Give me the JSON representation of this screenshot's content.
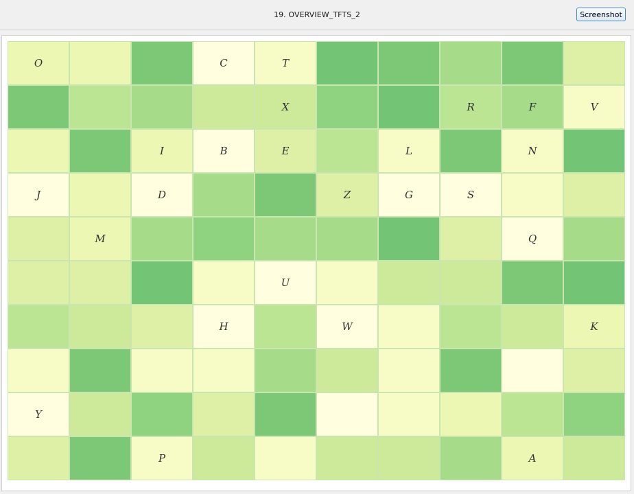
{
  "window": {
    "title": "19. OVERVIEW_TFTS_2",
    "screenshot_button_label": "Screenshot"
  },
  "grid": {
    "palette": [
      "#ffffe0",
      "#f7fbc6",
      "#ecf7b4",
      "#deefa6",
      "#cdea9a",
      "#bce593",
      "#a6dc89",
      "#8fd27f",
      "#7cc876",
      "#74c475"
    ],
    "rows": [
      [
        {
          "label": "O",
          "shade": 2
        },
        {
          "label": "",
          "shade": 2
        },
        {
          "label": "",
          "shade": 8
        },
        {
          "label": "C",
          "shade": 0
        },
        {
          "label": "T",
          "shade": 1
        },
        {
          "label": "",
          "shade": 9
        },
        {
          "label": "",
          "shade": 8
        },
        {
          "label": "",
          "shade": 6
        },
        {
          "label": "",
          "shade": 8
        },
        {
          "label": "",
          "shade": 3
        }
      ],
      [
        {
          "label": "",
          "shade": 8
        },
        {
          "label": "",
          "shade": 5
        },
        {
          "label": "",
          "shade": 6
        },
        {
          "label": "",
          "shade": 4
        },
        {
          "label": "X",
          "shade": 4
        },
        {
          "label": "",
          "shade": 7
        },
        {
          "label": "",
          "shade": 9
        },
        {
          "label": "R",
          "shade": 5
        },
        {
          "label": "F",
          "shade": 6
        },
        {
          "label": "V",
          "shade": 1
        }
      ],
      [
        {
          "label": "",
          "shade": 2
        },
        {
          "label": "",
          "shade": 8
        },
        {
          "label": "I",
          "shade": 2
        },
        {
          "label": "B",
          "shade": 0
        },
        {
          "label": "E",
          "shade": 3
        },
        {
          "label": "",
          "shade": 5
        },
        {
          "label": "L",
          "shade": 1
        },
        {
          "label": "",
          "shade": 8
        },
        {
          "label": "N",
          "shade": 1
        },
        {
          "label": "",
          "shade": 9
        }
      ],
      [
        {
          "label": "J",
          "shade": 0
        },
        {
          "label": "",
          "shade": 2
        },
        {
          "label": "D",
          "shade": 0
        },
        {
          "label": "",
          "shade": 6
        },
        {
          "label": "",
          "shade": 8
        },
        {
          "label": "Z",
          "shade": 3
        },
        {
          "label": "G",
          "shade": 0
        },
        {
          "label": "S",
          "shade": 0
        },
        {
          "label": "",
          "shade": 1
        },
        {
          "label": "",
          "shade": 3
        }
      ],
      [
        {
          "label": "",
          "shade": 3
        },
        {
          "label": "M",
          "shade": 2
        },
        {
          "label": "",
          "shade": 6
        },
        {
          "label": "",
          "shade": 7
        },
        {
          "label": "",
          "shade": 6
        },
        {
          "label": "",
          "shade": 6
        },
        {
          "label": "",
          "shade": 9
        },
        {
          "label": "",
          "shade": 3
        },
        {
          "label": "Q",
          "shade": 0
        },
        {
          "label": "",
          "shade": 6
        }
      ],
      [
        {
          "label": "",
          "shade": 3
        },
        {
          "label": "",
          "shade": 3
        },
        {
          "label": "",
          "shade": 9
        },
        {
          "label": "",
          "shade": 1
        },
        {
          "label": "U",
          "shade": 0
        },
        {
          "label": "",
          "shade": 1
        },
        {
          "label": "",
          "shade": 4
        },
        {
          "label": "",
          "shade": 4
        },
        {
          "label": "",
          "shade": 8
        },
        {
          "label": "",
          "shade": 9
        }
      ],
      [
        {
          "label": "",
          "shade": 5
        },
        {
          "label": "",
          "shade": 4
        },
        {
          "label": "",
          "shade": 3
        },
        {
          "label": "H",
          "shade": 0
        },
        {
          "label": "",
          "shade": 5
        },
        {
          "label": "W",
          "shade": 0
        },
        {
          "label": "",
          "shade": 1
        },
        {
          "label": "",
          "shade": 5
        },
        {
          "label": "",
          "shade": 4
        },
        {
          "label": "K",
          "shade": 2
        }
      ],
      [
        {
          "label": "",
          "shade": 1
        },
        {
          "label": "",
          "shade": 8
        },
        {
          "label": "",
          "shade": 1
        },
        {
          "label": "",
          "shade": 1
        },
        {
          "label": "",
          "shade": 6
        },
        {
          "label": "",
          "shade": 4
        },
        {
          "label": "",
          "shade": 1
        },
        {
          "label": "",
          "shade": 8
        },
        {
          "label": "",
          "shade": 0
        },
        {
          "label": "",
          "shade": 3
        }
      ],
      [
        {
          "label": "Y",
          "shade": 0
        },
        {
          "label": "",
          "shade": 4
        },
        {
          "label": "",
          "shade": 7
        },
        {
          "label": "",
          "shade": 3
        },
        {
          "label": "",
          "shade": 8
        },
        {
          "label": "",
          "shade": 0
        },
        {
          "label": "",
          "shade": 1
        },
        {
          "label": "",
          "shade": 2
        },
        {
          "label": "",
          "shade": 5
        },
        {
          "label": "",
          "shade": 7
        }
      ],
      [
        {
          "label": "",
          "shade": 3
        },
        {
          "label": "",
          "shade": 8
        },
        {
          "label": "P",
          "shade": 1
        },
        {
          "label": "",
          "shade": 4
        },
        {
          "label": "",
          "shade": 1
        },
        {
          "label": "",
          "shade": 4
        },
        {
          "label": "",
          "shade": 4
        },
        {
          "label": "",
          "shade": 6
        },
        {
          "label": "A",
          "shade": 2
        },
        {
          "label": "",
          "shade": 4
        }
      ]
    ]
  }
}
